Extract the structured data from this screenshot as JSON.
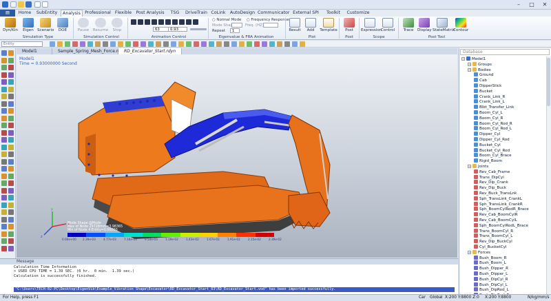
{
  "menu": {
    "tabs": [
      "Home",
      "SubEntity",
      "Analysis",
      "Professional",
      "Flexible",
      "Post Analysis",
      "TSG",
      "DriveTrain",
      "CoLink",
      "AutoDesign",
      "Communicator",
      "External SPI",
      "Toolkit",
      "Customize"
    ],
    "active": "Analysis"
  },
  "ribbon": {
    "dynkin": "Dyn/Kin",
    "eigen": "Eigen",
    "scenario": "Scenario",
    "doe": "DOE",
    "group_simtype": "Simulation Type",
    "pause": "Pause",
    "resume": "Resume",
    "stop": "Stop",
    "group_simcontrol": "Simulation Control",
    "frame_current": "63",
    "frame_time": "0.93",
    "group_anim": "Animation Control",
    "normal_mode": "Normal Mode",
    "freq_response": "Frequency Response",
    "mode_shape": "Mode Shape",
    "freq_hz": "Freq. (HZ)",
    "repeat": "Repeat",
    "group_eigen": "Eigenvalue & FRA Animation",
    "result": "Result",
    "add": "Add",
    "template": "Template",
    "group_plot": "Plot",
    "post": "Post",
    "group_post": "Post",
    "expression": "Expression",
    "control": "Control",
    "group_scope": "Scope",
    "trace": "Trace",
    "display": "Display",
    "statematrix": "StateMatrix",
    "contour": "Contour",
    "group_posttool": "Post Tool"
  },
  "toolbar": {
    "entity_field": "Entity"
  },
  "doc_tabs": [
    "Model1",
    "Sample_Spring_Mesh_Force.rdyn",
    "RD_Excavator_Start.rdyn"
  ],
  "viewport": {
    "model_name": "Model1",
    "time_label": "Time = 0.93000000 Second",
    "legend_title_1": "Mode Shape @Mode",
    "legend_title_2": "Max of Node 29728mm=3.98365",
    "legend_title_3": "Min of Node 4 Entity=0.00000",
    "legend_values": [
      "0.00e+00",
      "2.39e-03",
      "4.77e-03",
      "7.16e-03",
      "9.54e-03",
      "1.19e-02",
      "1.43e-02",
      "1.67e-02",
      "1.91e-02",
      "2.15e-02",
      "2.39e-02"
    ],
    "legend_colors": [
      "#0000c8",
      "#0050ff",
      "#00a8ff",
      "#00e0d0",
      "#00e060",
      "#60f000",
      "#c8f000",
      "#ffd000",
      "#ff8000",
      "#ff3000",
      "#d00000"
    ]
  },
  "right_panel": {
    "search_placeholder": "Database",
    "tree": [
      {
        "label": "Model1",
        "level": 0,
        "icon": "model"
      },
      {
        "label": "Groups",
        "level": 1,
        "icon": "folder"
      },
      {
        "label": "Bodies",
        "level": 1,
        "icon": "folder"
      },
      {
        "label": "Ground",
        "level": 2,
        "icon": "body"
      },
      {
        "label": "Cab",
        "level": 2,
        "icon": "body"
      },
      {
        "label": "DipperStick",
        "level": 2,
        "icon": "body"
      },
      {
        "label": "Bucket",
        "level": 2,
        "icon": "body"
      },
      {
        "label": "Crank_Link_R",
        "level": 2,
        "icon": "body"
      },
      {
        "label": "Crank_Link_L",
        "level": 2,
        "icon": "body"
      },
      {
        "label": "Blkt_Transfer_Link",
        "level": 2,
        "icon": "body"
      },
      {
        "label": "Boom_Cyl_L",
        "level": 2,
        "icon": "body"
      },
      {
        "label": "Boom_Cyl_R",
        "level": 2,
        "icon": "body"
      },
      {
        "label": "Boom_Cyl_Rod_R",
        "level": 2,
        "icon": "body"
      },
      {
        "label": "Boom_Cyl_Rod_L",
        "level": 2,
        "icon": "body"
      },
      {
        "label": "Dipper_Cyl",
        "level": 2,
        "icon": "body"
      },
      {
        "label": "Dipper_Cyl_Rod",
        "level": 2,
        "icon": "body"
      },
      {
        "label": "Bucket_Cyl",
        "level": 2,
        "icon": "body"
      },
      {
        "label": "Bucket_Cyl_Rod",
        "level": 2,
        "icon": "body"
      },
      {
        "label": "Boom_Cyl_Brace",
        "level": 2,
        "icon": "body"
      },
      {
        "label": "Rigid_Boom",
        "level": 2,
        "icon": "body"
      },
      {
        "label": "Joints",
        "level": 1,
        "icon": "folder"
      },
      {
        "label": "Rev_Cab_Frame",
        "level": 2,
        "icon": "joint"
      },
      {
        "label": "Trans_DipCyl",
        "level": 2,
        "icon": "joint"
      },
      {
        "label": "Rev_Dip_Crank",
        "level": 2,
        "icon": "joint"
      },
      {
        "label": "Rev_Dip_Buck",
        "level": 2,
        "icon": "joint"
      },
      {
        "label": "Rev_Buck_TransLnk",
        "level": 2,
        "icon": "joint"
      },
      {
        "label": "Sph_TransLink_CrankL",
        "level": 2,
        "icon": "joint"
      },
      {
        "label": "Sph_TransLink_CrankR",
        "level": 2,
        "icon": "joint"
      },
      {
        "label": "Sph_BoomCylRodR_Brace",
        "level": 2,
        "icon": "joint"
      },
      {
        "label": "Rev_Cab_BoomCylR",
        "level": 2,
        "icon": "joint"
      },
      {
        "label": "Rev_Cab_BoomCylL",
        "level": 2,
        "icon": "joint"
      },
      {
        "label": "Sph_BoomCylRodL_Brace",
        "level": 2,
        "icon": "joint"
      },
      {
        "label": "Trans_BoomCyl_R",
        "level": 2,
        "icon": "joint"
      },
      {
        "label": "Trans_BoomCyl_L",
        "level": 2,
        "icon": "joint"
      },
      {
        "label": "Rev_Dip_BuckCyl",
        "level": 2,
        "icon": "joint"
      },
      {
        "label": "Cyl_BucketCyl",
        "level": 2,
        "icon": "joint"
      },
      {
        "label": "Forces",
        "level": 1,
        "icon": "folder"
      },
      {
        "label": "Bush_Boom_R",
        "level": 2,
        "icon": "force"
      },
      {
        "label": "Bush_Boom_L",
        "level": 2,
        "icon": "force"
      },
      {
        "label": "Bush_Dipper_R",
        "level": 2,
        "icon": "force"
      },
      {
        "label": "Bush_Dipper_L",
        "level": 2,
        "icon": "force"
      },
      {
        "label": "Bush_DipCyl_R",
        "level": 2,
        "icon": "force"
      },
      {
        "label": "Bush_DipCyl_L",
        "level": 2,
        "icon": "force"
      },
      {
        "label": "Bush_DipRod_L",
        "level": 2,
        "icon": "force"
      },
      {
        "label": "Bush_DipRod_R",
        "level": 2,
        "icon": "force"
      }
    ]
  },
  "message": {
    "title": "Message",
    "lines": [
      "",
      "Calculation Time Information",
      "> USED CPU TIME = 1.39 SEC. (0 hr.  0 min.  1.39 sec.)",
      "",
      "Calculation is successfully finished."
    ],
    "highlight": "\"C:\\Users\\TECH-02-PC\\Desktop\\EigenVib\\Example_Vibration Shape\\Excavator\\RD_Excavator_Start_03\\RD_Excavator_Start.vod\" has been imported successfully."
  },
  "status": {
    "help": "For Help, press F1",
    "car": "Car",
    "global": "Global",
    "coords": "X:200 Y:8800 Z:0",
    "coords2": "X:200 Y:8800",
    "units": "N/kg/mm/s"
  }
}
